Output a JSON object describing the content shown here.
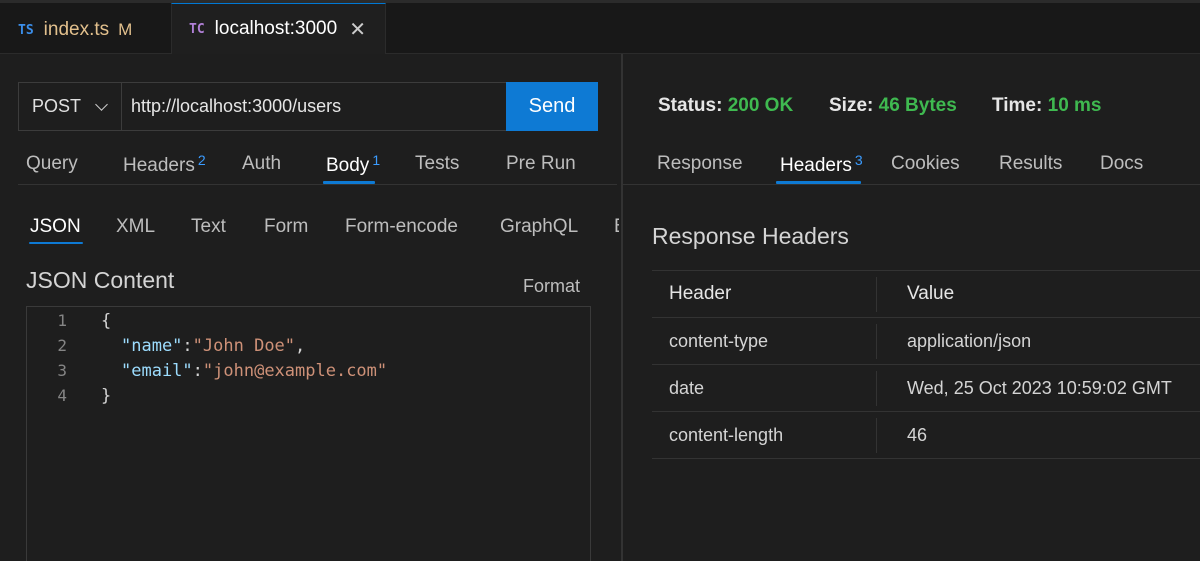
{
  "tabs": [
    {
      "lang": "TS",
      "name": "index.ts",
      "modified": "M"
    },
    {
      "lang": "TC",
      "name": "localhost:3000",
      "close": "✕"
    }
  ],
  "request": {
    "method": "POST",
    "url": "http://localhost:3000/users",
    "send_label": "Send"
  },
  "request_tabs": [
    {
      "label": "Query",
      "badge": ""
    },
    {
      "label": "Headers",
      "badge": "2"
    },
    {
      "label": "Auth",
      "badge": ""
    },
    {
      "label": "Body",
      "badge": "1"
    },
    {
      "label": "Tests",
      "badge": ""
    },
    {
      "label": "Pre Run",
      "badge": ""
    }
  ],
  "body_tabs": [
    "JSON",
    "XML",
    "Text",
    "Form",
    "Form-encode",
    "GraphQL",
    "B"
  ],
  "json_content": {
    "title": "JSON Content",
    "format_label": "Format",
    "line_numbers": [
      "1",
      "2",
      "3",
      "4"
    ],
    "lines": [
      {
        "open": "{"
      },
      {
        "key": "\"name\"",
        "colon": ":",
        "value": "\"John Doe\"",
        "comma": ","
      },
      {
        "key": "\"email\"",
        "colon": ":",
        "value": "\"john@example.com\"",
        "comma": ""
      },
      {
        "close": "}"
      }
    ]
  },
  "status_bar": {
    "status_label": "Status:",
    "status_value": "200 OK",
    "size_label": "Size:",
    "size_value": "46 Bytes",
    "time_label": "Time:",
    "time_value": "10 ms"
  },
  "response_tabs": [
    {
      "label": "Response",
      "badge": ""
    },
    {
      "label": "Headers",
      "badge": "3"
    },
    {
      "label": "Cookies",
      "badge": ""
    },
    {
      "label": "Results",
      "badge": ""
    },
    {
      "label": "Docs",
      "badge": ""
    }
  ],
  "response_headers": {
    "title": "Response Headers",
    "columns": [
      "Header",
      "Value"
    ],
    "rows": [
      [
        "content-type",
        "application/json"
      ],
      [
        "date",
        "Wed, 25 Oct 2023 10:59:02 GMT"
      ],
      [
        "content-length",
        "46"
      ]
    ]
  },
  "colors": {
    "accent": "#0e7ad4",
    "status_ok": "#3fb950",
    "badge": "#3b9cff"
  }
}
